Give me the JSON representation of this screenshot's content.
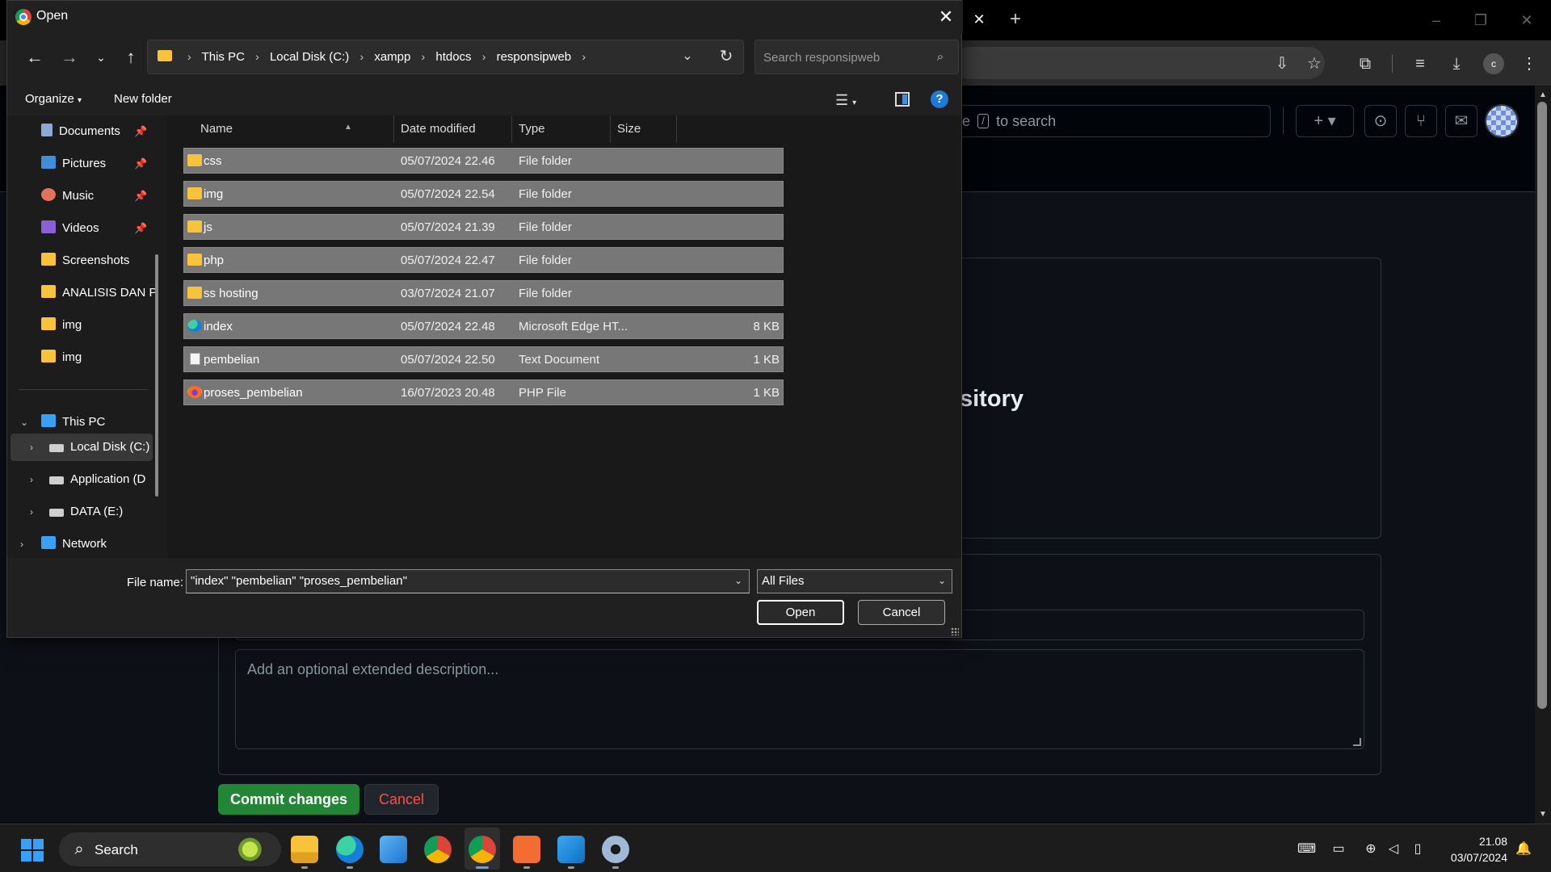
{
  "browser": {
    "gh_search_prefix": "Type",
    "gh_search_hint_fragment": "pe",
    "gh_search_key": "/",
    "gh_search_suffix": "to search",
    "profile_initial": "c",
    "heading_fragment": "sitory",
    "desc_placeholder": "Add an optional extended description...",
    "commit_label": "Commit changes",
    "cancel_label": "Cancel"
  },
  "dialog": {
    "title": "Open",
    "breadcrumbs": [
      "This PC",
      "Local Disk (C:)",
      "xampp",
      "htdocs",
      "responsipweb"
    ],
    "search_placeholder": "Search responsipweb",
    "organize_label": "Organize",
    "new_folder_label": "New folder",
    "nav_quick": [
      {
        "label": "Documents",
        "icon": "documents-icon",
        "pinned": true
      },
      {
        "label": "Pictures",
        "icon": "pictures-icon",
        "pinned": true
      },
      {
        "label": "Music",
        "icon": "music-icon",
        "pinned": true
      },
      {
        "label": "Videos",
        "icon": "videos-icon",
        "pinned": true
      },
      {
        "label": "Screenshots",
        "icon": "folder-icon",
        "pinned": false
      },
      {
        "label": "ANALISIS DAN P",
        "icon": "folder-icon",
        "pinned": false
      },
      {
        "label": "img",
        "icon": "folder-icon",
        "pinned": false
      },
      {
        "label": "img",
        "icon": "folder-icon",
        "pinned": false
      }
    ],
    "nav_tree": [
      {
        "label": "This PC",
        "icon": "pc-icon",
        "expanded": true
      },
      {
        "label": "Local Disk (C:)",
        "icon": "drive-icon",
        "selected": true
      },
      {
        "label": "Application (D",
        "icon": "drive-icon"
      },
      {
        "label": "DATA (E:)",
        "icon": "drive-icon"
      },
      {
        "label": "Network",
        "icon": "network-icon"
      }
    ],
    "columns": [
      "Name",
      "Date modified",
      "Type",
      "Size"
    ],
    "files": [
      {
        "name": "css",
        "date": "05/07/2024 22.46",
        "type": "File folder",
        "size": "",
        "icon": "folder"
      },
      {
        "name": "img",
        "date": "05/07/2024 22.54",
        "type": "File folder",
        "size": "",
        "icon": "folder"
      },
      {
        "name": "js",
        "date": "05/07/2024 21.39",
        "type": "File folder",
        "size": "",
        "icon": "folder"
      },
      {
        "name": "php",
        "date": "05/07/2024 22.47",
        "type": "File folder",
        "size": "",
        "icon": "folder"
      },
      {
        "name": "ss hosting",
        "date": "03/07/2024 21.07",
        "type": "File folder",
        "size": "",
        "icon": "folder"
      },
      {
        "name": "index",
        "date": "05/07/2024 22.48",
        "type": "Microsoft Edge HT...",
        "size": "8 KB",
        "icon": "edge"
      },
      {
        "name": "pembelian",
        "date": "05/07/2024 22.50",
        "type": "Text Document",
        "size": "1 KB",
        "icon": "text"
      },
      {
        "name": "proses_pembelian",
        "date": "16/07/2023 20.48",
        "type": "PHP File",
        "size": "1 KB",
        "icon": "php"
      }
    ],
    "file_name_label": "File name:",
    "file_name_value": "\"index\" \"pembelian\" \"proses_pembelian\"",
    "file_type_value": "All Files",
    "open_label": "Open",
    "cancel_label": "Cancel"
  },
  "taskbar": {
    "search_label": "Search",
    "time": "21.08",
    "date": "03/07/2024"
  }
}
